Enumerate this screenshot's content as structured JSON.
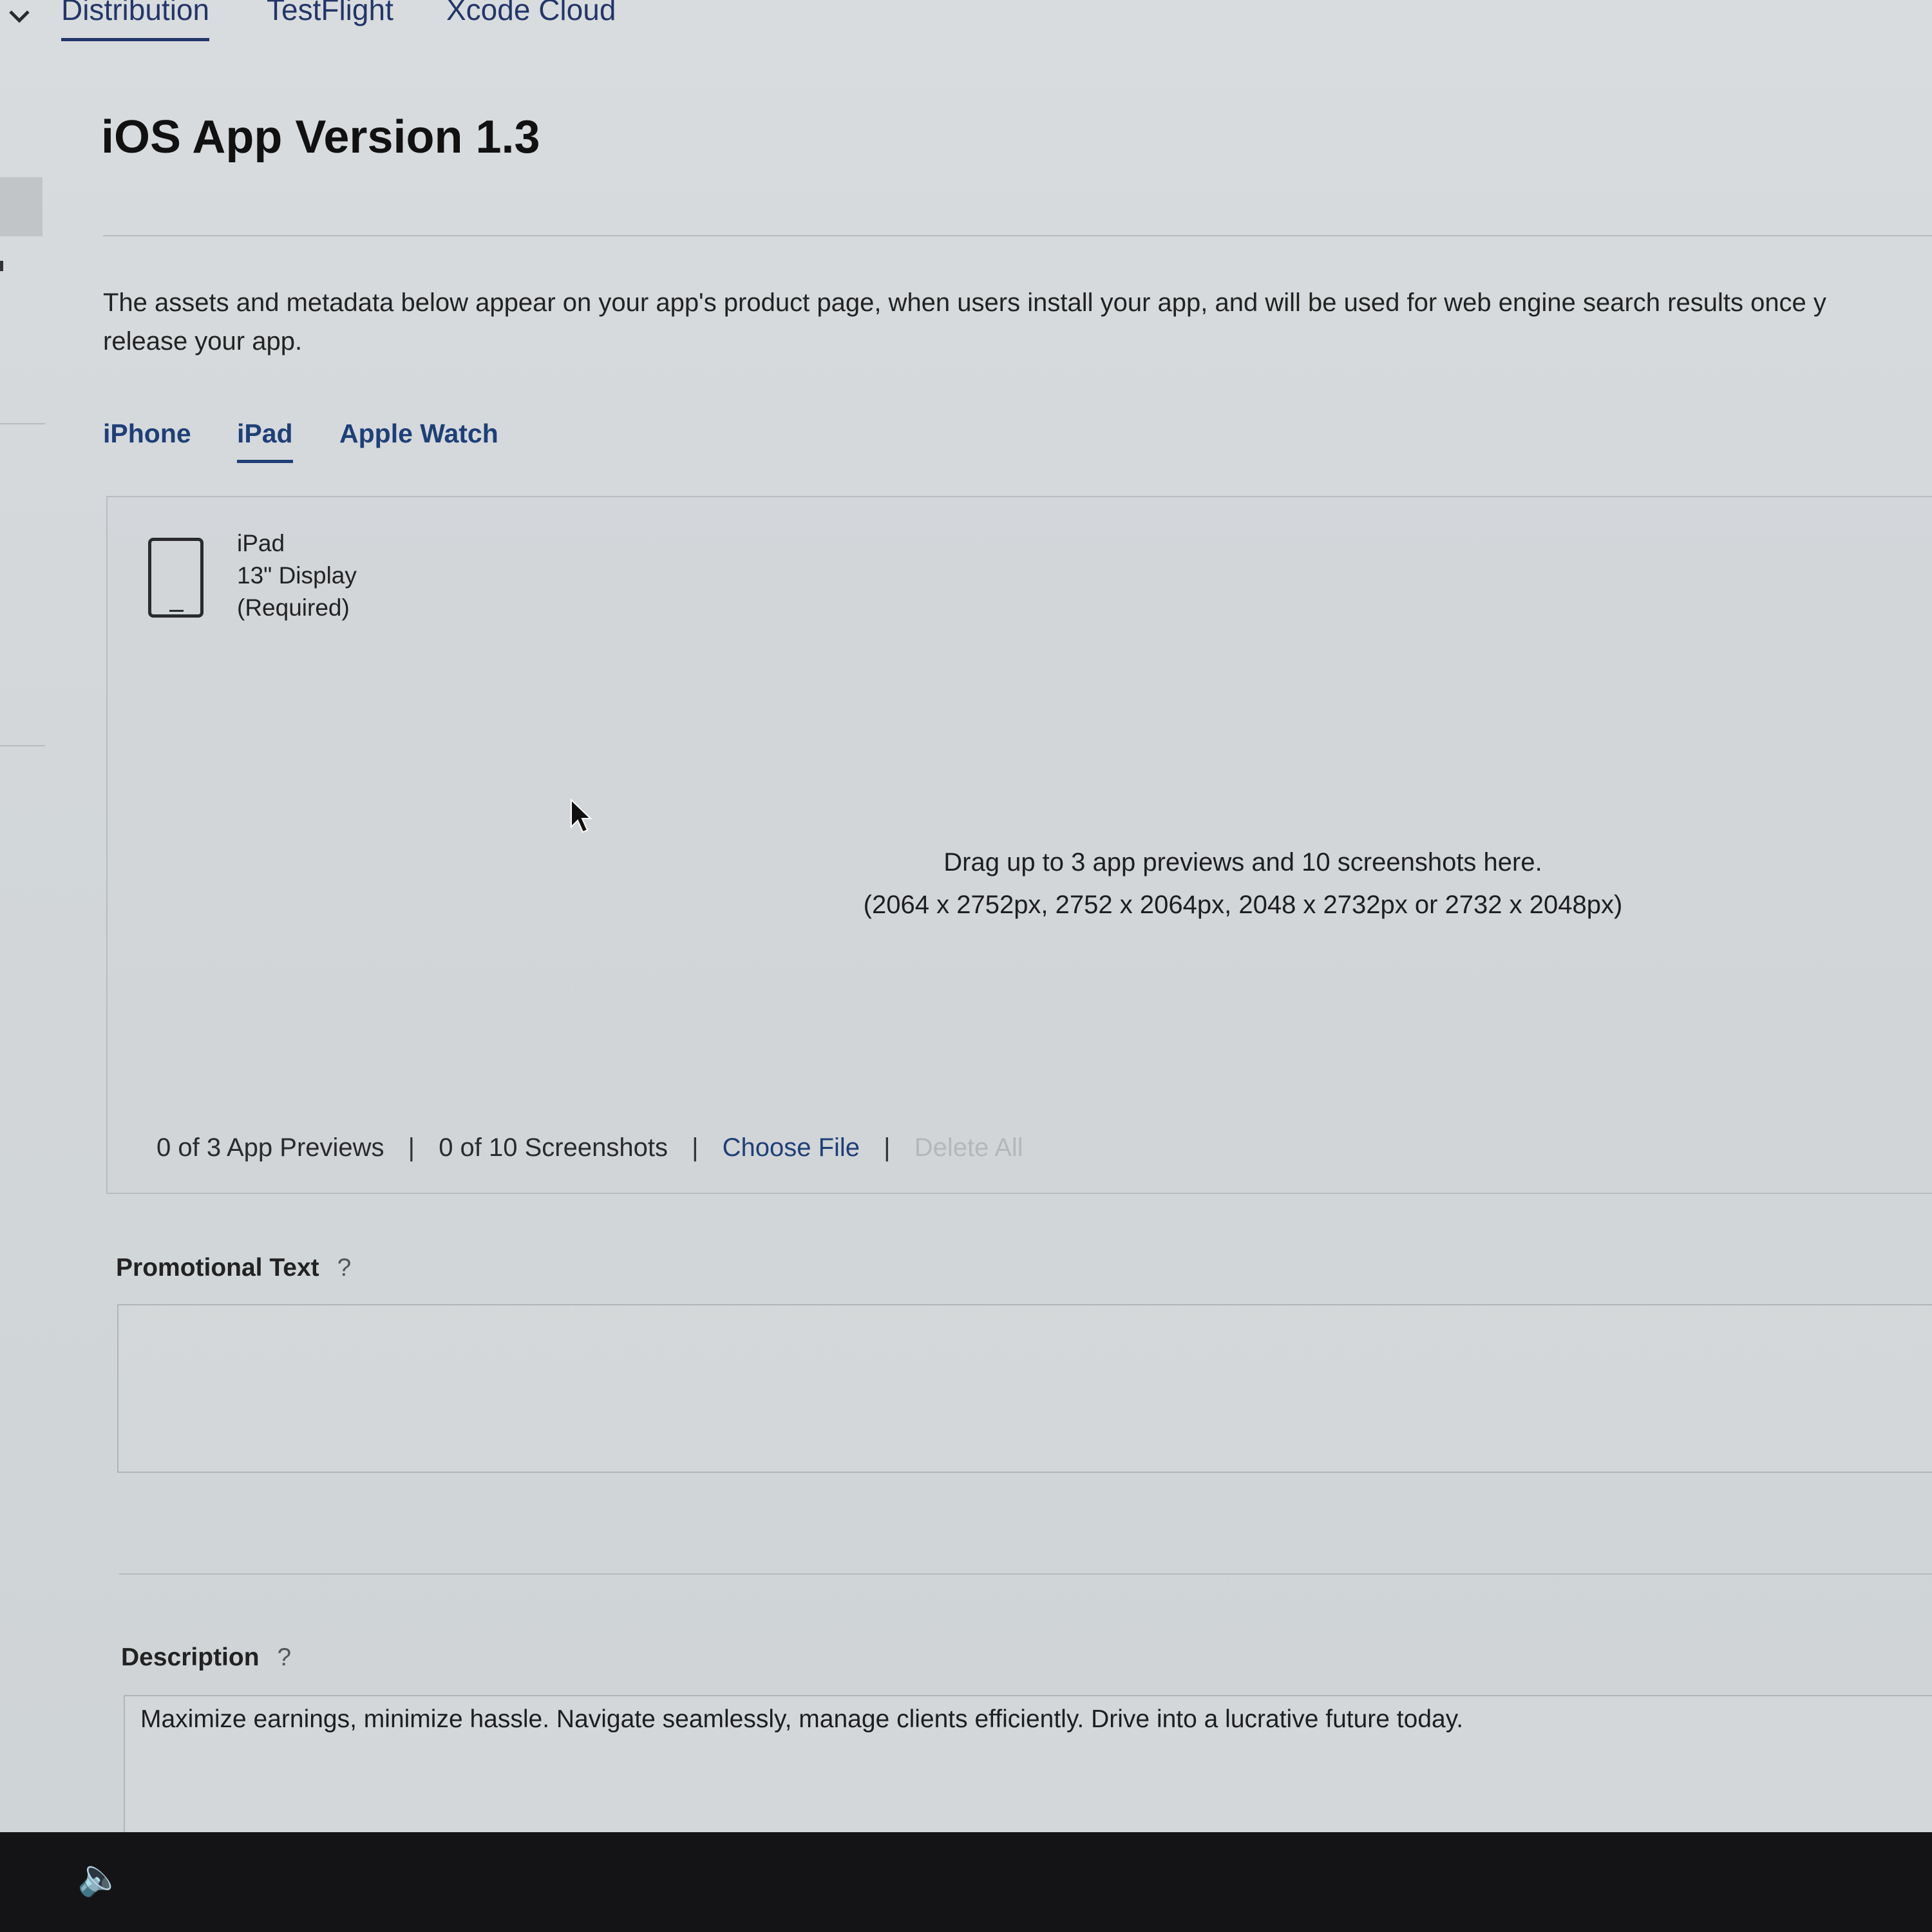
{
  "top_nav": {
    "tabs": [
      {
        "label": "Distribution",
        "active": true
      },
      {
        "label": "TestFlight",
        "active": false
      },
      {
        "label": "Xcode Cloud",
        "active": false
      }
    ]
  },
  "page": {
    "title": "iOS App Version 1.3",
    "intro_line1": "The assets and metadata below appear on your app's product page, when users install your app, and will be used for web engine search results once y",
    "intro_line2": "release your app."
  },
  "device_tabs": [
    {
      "label": "iPhone",
      "active": false
    },
    {
      "label": "iPad",
      "active": true
    },
    {
      "label": "Apple Watch",
      "active": false
    }
  ],
  "media": {
    "device_name": "iPad",
    "display_size": "13\" Display",
    "requirement": "(Required)",
    "drop_line1": "Drag up to 3 app previews and 10 screenshots here.",
    "drop_line2": "(2064 x 2752px, 2752 x 2064px, 2048 x 2732px or 2732 x 2048px)",
    "previews_count": "0 of 3 App Previews",
    "screenshots_count": "0 of 10 Screenshots",
    "choose_file": "Choose File",
    "delete_all": "Delete All",
    "separator": "|"
  },
  "promotional_text": {
    "label": "Promotional Text",
    "help": "?",
    "value": ""
  },
  "description": {
    "label": "Description",
    "help": "?",
    "value": "Maximize earnings, minimize hassle. Navigate seamlessly, manage clients efficiently. Drive into a lucrative future today."
  },
  "colors": {
    "accent": "#1e3f78",
    "nav_text": "#23366a",
    "disabled": "#b4b8bb"
  }
}
